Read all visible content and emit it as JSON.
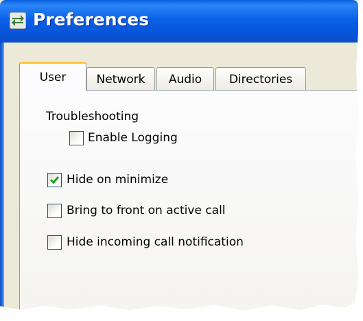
{
  "window": {
    "title": "Preferences",
    "icon": "app-swap-icon"
  },
  "tabs": [
    {
      "label": "User",
      "active": true
    },
    {
      "label": "Network",
      "active": false
    },
    {
      "label": "Audio",
      "active": false
    },
    {
      "label": "Directories",
      "active": false
    }
  ],
  "user_tab": {
    "troubleshooting_heading": "Troubleshooting",
    "options": [
      {
        "label": "Enable Logging",
        "checked": false
      },
      {
        "label": "Hide on minimize",
        "checked": true
      },
      {
        "label": "Bring to front on active call",
        "checked": false
      },
      {
        "label": "Hide incoming call notification",
        "checked": false
      }
    ]
  },
  "colors": {
    "titlebar": "#0754d8",
    "window_bg": "#ece9d8",
    "active_tab_accent": "#ffc83c",
    "checkmark": "#21a121"
  }
}
